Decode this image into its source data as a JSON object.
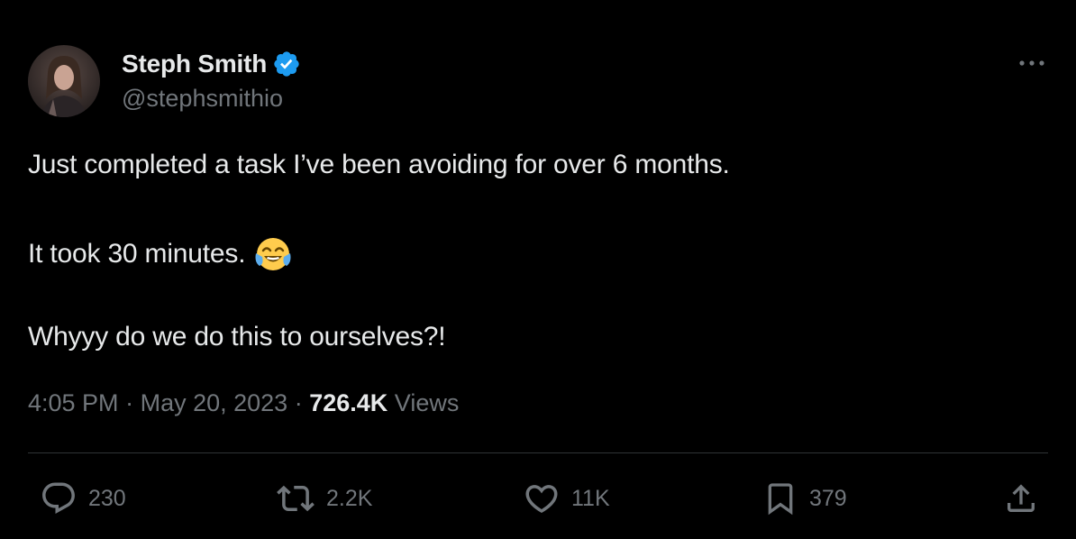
{
  "author": {
    "display_name": "Steph Smith",
    "handle": "@stephsmithio",
    "verified": true,
    "verified_color": "#1d9bf0"
  },
  "tweet": {
    "lines": [
      "Just completed a task I’ve been avoiding for over 6 months.",
      "It took 30 minutes.",
      "Whyyy do we do this to ourselves?!"
    ],
    "emoji": "face-with-tears-of-joy"
  },
  "meta": {
    "time": "4:05 PM",
    "separator": "·",
    "date": "May 20, 2023",
    "views_count": "726.4K",
    "views_label": "Views"
  },
  "actions": {
    "reply": {
      "icon": "reply-icon",
      "count": "230"
    },
    "retweet": {
      "icon": "retweet-icon",
      "count": "2.2K"
    },
    "like": {
      "icon": "heart-icon",
      "count": "11K"
    },
    "bookmark": {
      "icon": "bookmark-icon",
      "count": "379"
    },
    "share": {
      "icon": "share-icon"
    }
  },
  "colors": {
    "background": "#000000",
    "primary_text": "#e7e9ea",
    "secondary_text": "#71767b",
    "divider": "#2f3336"
  }
}
